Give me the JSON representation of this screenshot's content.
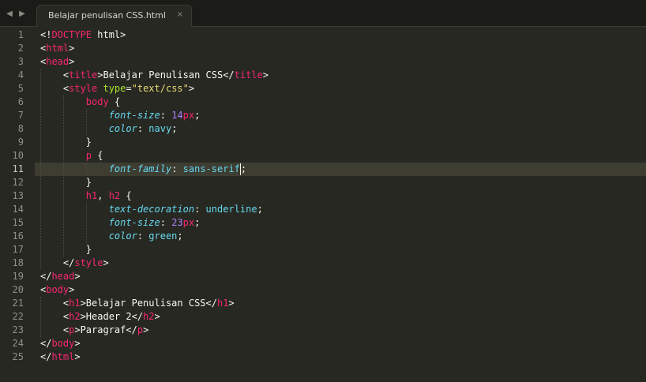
{
  "tabbar": {
    "nav_left_glyph": "◀",
    "nav_right_glyph": "▶",
    "tab_title": "Belajar penulisan CSS.html",
    "tab_close_glyph": "×"
  },
  "editor": {
    "active_line": 11,
    "line_numbers": [
      "1",
      "2",
      "3",
      "4",
      "5",
      "6",
      "7",
      "8",
      "9",
      "10",
      "11",
      "12",
      "13",
      "14",
      "15",
      "16",
      "17",
      "18",
      "19",
      "20",
      "21",
      "22",
      "23",
      "24",
      "25"
    ],
    "lines": [
      [
        [
          "pl",
          "<!"
        ],
        [
          "tag",
          "DOCTYPE"
        ],
        [
          "pl",
          " html>"
        ]
      ],
      [
        [
          "pl",
          "<"
        ],
        [
          "tag",
          "html"
        ],
        [
          "pl",
          ">"
        ]
      ],
      [
        [
          "pl",
          "<"
        ],
        [
          "tag",
          "head"
        ],
        [
          "pl",
          ">"
        ]
      ],
      [
        [
          "pl",
          "    <"
        ],
        [
          "tag",
          "title"
        ],
        [
          "pl",
          ">Belajar Penulisan CSS</"
        ],
        [
          "tag",
          "title"
        ],
        [
          "pl",
          ">"
        ]
      ],
      [
        [
          "pl",
          "    <"
        ],
        [
          "tag",
          "style"
        ],
        [
          "pl",
          " "
        ],
        [
          "attr",
          "type"
        ],
        [
          "pl",
          "="
        ],
        [
          "str",
          "\"text/css\""
        ],
        [
          "pl",
          ">"
        ]
      ],
      [
        [
          "pl",
          "        "
        ],
        [
          "tag",
          "body"
        ],
        [
          "pl",
          " {"
        ]
      ],
      [
        [
          "pl",
          "            "
        ],
        [
          "prop",
          "font-size"
        ],
        [
          "pl",
          ": "
        ],
        [
          "num",
          "14"
        ],
        [
          "unit",
          "px"
        ],
        [
          "pl",
          ";"
        ]
      ],
      [
        [
          "pl",
          "            "
        ],
        [
          "prop",
          "color"
        ],
        [
          "pl",
          ": "
        ],
        [
          "val",
          "navy"
        ],
        [
          "pl",
          ";"
        ]
      ],
      [
        [
          "pl",
          "        }"
        ]
      ],
      [
        [
          "pl",
          "        "
        ],
        [
          "tag",
          "p"
        ],
        [
          "pl",
          " {"
        ]
      ],
      [
        [
          "pl",
          "            "
        ],
        [
          "prop",
          "font-family"
        ],
        [
          "pl",
          ": "
        ],
        [
          "val",
          "sans-serif"
        ],
        [
          "cursor",
          ""
        ],
        [
          "pl",
          ";"
        ]
      ],
      [
        [
          "pl",
          "        }"
        ]
      ],
      [
        [
          "pl",
          "        "
        ],
        [
          "tag",
          "h1"
        ],
        [
          "pl",
          ", "
        ],
        [
          "tag",
          "h2"
        ],
        [
          "pl",
          " {"
        ]
      ],
      [
        [
          "pl",
          "            "
        ],
        [
          "prop",
          "text-decoration"
        ],
        [
          "pl",
          ": "
        ],
        [
          "val",
          "underline"
        ],
        [
          "pl",
          ";"
        ]
      ],
      [
        [
          "pl",
          "            "
        ],
        [
          "prop",
          "font-size"
        ],
        [
          "pl",
          ": "
        ],
        [
          "num",
          "23"
        ],
        [
          "unit",
          "px"
        ],
        [
          "pl",
          ";"
        ]
      ],
      [
        [
          "pl",
          "            "
        ],
        [
          "prop",
          "color"
        ],
        [
          "pl",
          ": "
        ],
        [
          "val",
          "green"
        ],
        [
          "pl",
          ";"
        ]
      ],
      [
        [
          "pl",
          "        }"
        ]
      ],
      [
        [
          "pl",
          "    </"
        ],
        [
          "tag",
          "style"
        ],
        [
          "pl",
          ">"
        ]
      ],
      [
        [
          "pl",
          "</"
        ],
        [
          "tag",
          "head"
        ],
        [
          "pl",
          ">"
        ]
      ],
      [
        [
          "pl",
          "<"
        ],
        [
          "tag",
          "body"
        ],
        [
          "pl",
          ">"
        ]
      ],
      [
        [
          "pl",
          "    <"
        ],
        [
          "tag",
          "h1"
        ],
        [
          "pl",
          ">Belajar Penulisan CSS</"
        ],
        [
          "tag",
          "h1"
        ],
        [
          "pl",
          ">"
        ]
      ],
      [
        [
          "pl",
          "    <"
        ],
        [
          "tag",
          "h2"
        ],
        [
          "pl",
          ">Header 2</"
        ],
        [
          "tag",
          "h2"
        ],
        [
          "pl",
          ">"
        ]
      ],
      [
        [
          "pl",
          "    <"
        ],
        [
          "tag",
          "p"
        ],
        [
          "pl",
          ">Paragraf</"
        ],
        [
          "tag",
          "p"
        ],
        [
          "pl",
          ">"
        ]
      ],
      [
        [
          "pl",
          "</"
        ],
        [
          "tag",
          "body"
        ],
        [
          "pl",
          ">"
        ]
      ],
      [
        [
          "pl",
          "</"
        ],
        [
          "tag",
          "html"
        ],
        [
          "pl",
          ">"
        ]
      ]
    ]
  },
  "colors": {
    "background": "#272822",
    "tag": "#f92672",
    "attribute": "#a6e22e",
    "string": "#e6db74",
    "property": "#66d9ef",
    "number": "#ae81ff",
    "line_highlight": "#3e3d32"
  },
  "icons": {
    "nav_left": "chevron-left-icon",
    "nav_right": "chevron-right-icon",
    "tab_close": "close-icon"
  }
}
